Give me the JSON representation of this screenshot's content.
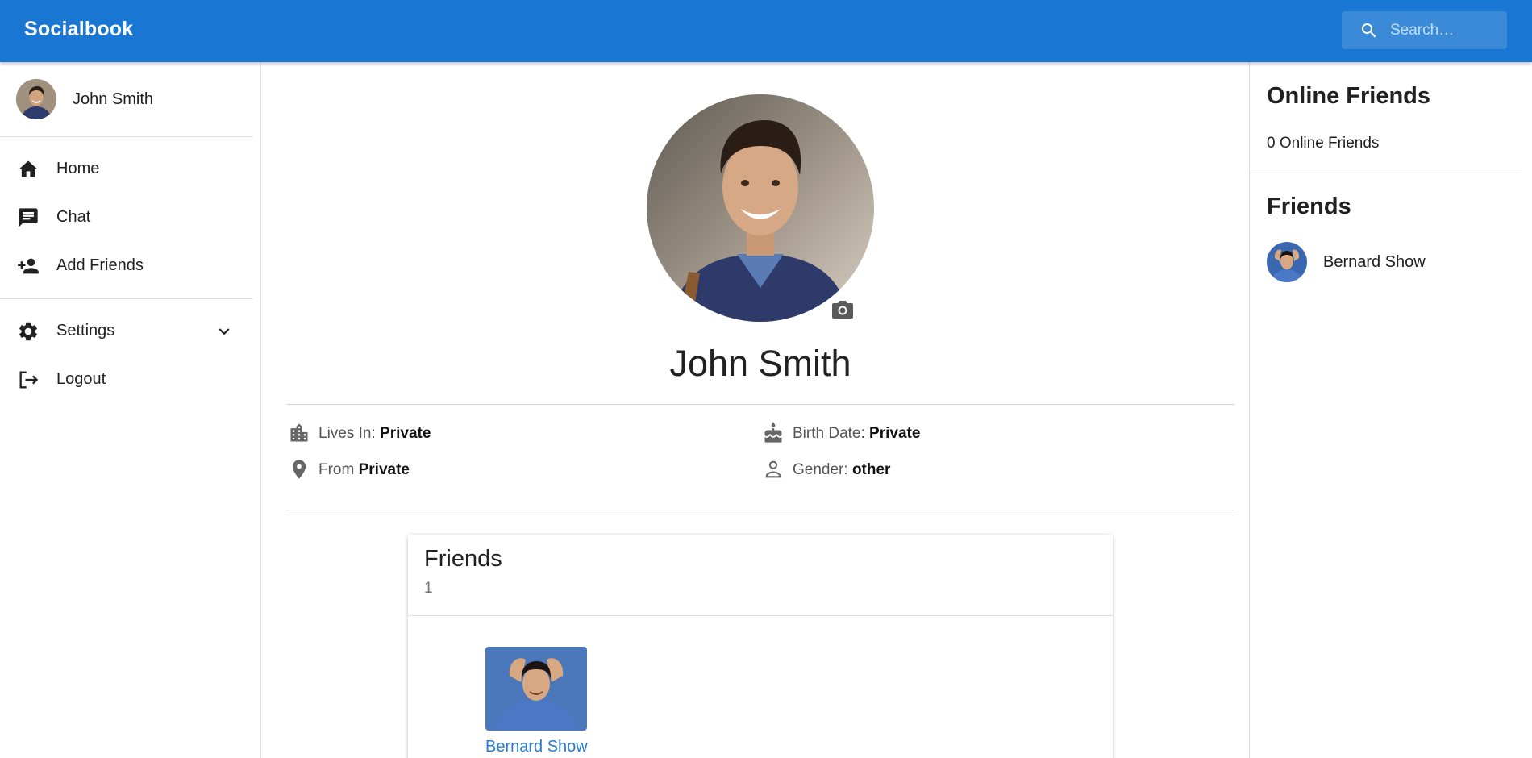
{
  "header": {
    "brand": "Socialbook",
    "search_placeholder": "Search…",
    "bg_color": "#1976d2"
  },
  "sidebar": {
    "user_name": "John Smith",
    "items": [
      {
        "label": "Home",
        "icon": "home-icon"
      },
      {
        "label": "Chat",
        "icon": "chat-icon"
      },
      {
        "label": "Add Friends",
        "icon": "add-friend-icon"
      },
      {
        "label": "Settings",
        "icon": "gear-icon"
      },
      {
        "label": "Logout",
        "icon": "logout-icon"
      }
    ]
  },
  "profile": {
    "name": "John Smith",
    "lives_in_label": "Lives In:",
    "lives_in_value": "Private",
    "from_label": "From",
    "from_value": "Private",
    "birth_label": "Birth Date:",
    "birth_value": "Private",
    "gender_label": "Gender:",
    "gender_value": "other"
  },
  "friends_card": {
    "title": "Friends",
    "count": "1",
    "friends": [
      {
        "name": "Bernard Show"
      }
    ]
  },
  "right_panel": {
    "online_title": "Online Friends",
    "online_count_text": "0 Online Friends",
    "friends_title": "Friends",
    "friends": [
      {
        "name": "Bernard Show"
      }
    ]
  },
  "colors": {
    "primary": "#1976d2",
    "link": "#2b7bd3"
  }
}
